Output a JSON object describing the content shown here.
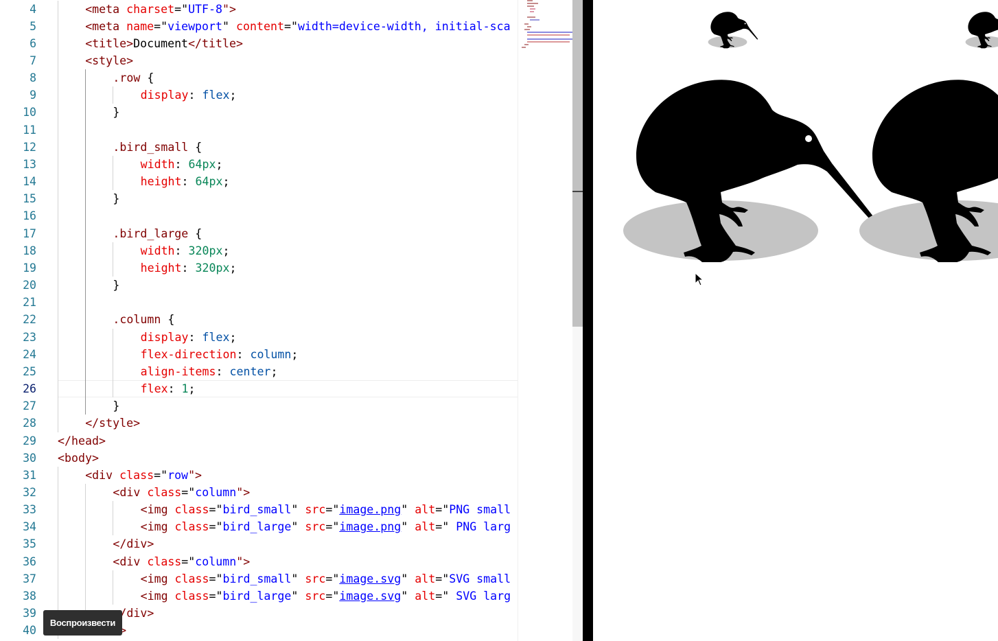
{
  "editor": {
    "active_line": "26",
    "lines": [
      {
        "n": "4",
        "indent": 1,
        "tokens": [
          {
            "t": "<meta ",
            "c": "tag"
          },
          {
            "t": "charset",
            "c": "attr"
          },
          {
            "t": "=\"",
            "c": "txt"
          },
          {
            "t": "UTF-8",
            "c": "str"
          },
          {
            "t": "\">",
            "c": "tag"
          }
        ]
      },
      {
        "n": "5",
        "indent": 1,
        "tokens": [
          {
            "t": "<meta ",
            "c": "tag"
          },
          {
            "t": "name",
            "c": "attr"
          },
          {
            "t": "=\"",
            "c": "txt"
          },
          {
            "t": "viewport",
            "c": "str"
          },
          {
            "t": "\" ",
            "c": "txt"
          },
          {
            "t": "content",
            "c": "attr"
          },
          {
            "t": "=\"",
            "c": "txt"
          },
          {
            "t": "width=device-width, initial-sca",
            "c": "str"
          }
        ]
      },
      {
        "n": "6",
        "indent": 1,
        "tokens": [
          {
            "t": "<title>",
            "c": "tag"
          },
          {
            "t": "Document",
            "c": "txt"
          },
          {
            "t": "</title>",
            "c": "tag"
          }
        ]
      },
      {
        "n": "7",
        "indent": 1,
        "tokens": [
          {
            "t": "<style>",
            "c": "tag"
          }
        ]
      },
      {
        "n": "8",
        "indent": 2,
        "tokens": [
          {
            "t": ".row",
            "c": "sel"
          },
          {
            "t": " {",
            "c": "txt"
          }
        ]
      },
      {
        "n": "9",
        "indent": 3,
        "tokens": [
          {
            "t": "display",
            "c": "prop"
          },
          {
            "t": ": ",
            "c": "txt"
          },
          {
            "t": "flex",
            "c": "val"
          },
          {
            "t": ";",
            "c": "txt"
          }
        ]
      },
      {
        "n": "10",
        "indent": 2,
        "tokens": [
          {
            "t": "}",
            "c": "txt"
          }
        ]
      },
      {
        "n": "11",
        "indent": 0,
        "tokens": []
      },
      {
        "n": "12",
        "indent": 2,
        "tokens": [
          {
            "t": ".bird_small",
            "c": "sel"
          },
          {
            "t": " {",
            "c": "txt"
          }
        ]
      },
      {
        "n": "13",
        "indent": 3,
        "tokens": [
          {
            "t": "width",
            "c": "prop"
          },
          {
            "t": ": ",
            "c": "txt"
          },
          {
            "t": "64px",
            "c": "num"
          },
          {
            "t": ";",
            "c": "txt"
          }
        ]
      },
      {
        "n": "14",
        "indent": 3,
        "tokens": [
          {
            "t": "height",
            "c": "prop"
          },
          {
            "t": ": ",
            "c": "txt"
          },
          {
            "t": "64px",
            "c": "num"
          },
          {
            "t": ";",
            "c": "txt"
          }
        ]
      },
      {
        "n": "15",
        "indent": 2,
        "tokens": [
          {
            "t": "}",
            "c": "txt"
          }
        ]
      },
      {
        "n": "16",
        "indent": 0,
        "tokens": []
      },
      {
        "n": "17",
        "indent": 2,
        "tokens": [
          {
            "t": ".bird_large",
            "c": "sel"
          },
          {
            "t": " {",
            "c": "txt"
          }
        ]
      },
      {
        "n": "18",
        "indent": 3,
        "tokens": [
          {
            "t": "width",
            "c": "prop"
          },
          {
            "t": ": ",
            "c": "txt"
          },
          {
            "t": "320px",
            "c": "num"
          },
          {
            "t": ";",
            "c": "txt"
          }
        ]
      },
      {
        "n": "19",
        "indent": 3,
        "tokens": [
          {
            "t": "height",
            "c": "prop"
          },
          {
            "t": ": ",
            "c": "txt"
          },
          {
            "t": "320px",
            "c": "num"
          },
          {
            "t": ";",
            "c": "txt"
          }
        ]
      },
      {
        "n": "20",
        "indent": 2,
        "tokens": [
          {
            "t": "}",
            "c": "txt"
          }
        ]
      },
      {
        "n": "21",
        "indent": 0,
        "tokens": []
      },
      {
        "n": "22",
        "indent": 2,
        "tokens": [
          {
            "t": ".column",
            "c": "sel"
          },
          {
            "t": " {",
            "c": "txt"
          }
        ]
      },
      {
        "n": "23",
        "indent": 3,
        "tokens": [
          {
            "t": "display",
            "c": "prop"
          },
          {
            "t": ": ",
            "c": "txt"
          },
          {
            "t": "flex",
            "c": "val"
          },
          {
            "t": ";",
            "c": "txt"
          }
        ]
      },
      {
        "n": "24",
        "indent": 3,
        "tokens": [
          {
            "t": "flex-direction",
            "c": "prop"
          },
          {
            "t": ": ",
            "c": "txt"
          },
          {
            "t": "column",
            "c": "val"
          },
          {
            "t": ";",
            "c": "txt"
          }
        ]
      },
      {
        "n": "25",
        "indent": 3,
        "tokens": [
          {
            "t": "align-items",
            "c": "prop"
          },
          {
            "t": ": ",
            "c": "txt"
          },
          {
            "t": "center",
            "c": "val"
          },
          {
            "t": ";",
            "c": "txt"
          }
        ]
      },
      {
        "n": "26",
        "indent": 3,
        "tokens": [
          {
            "t": "flex",
            "c": "prop"
          },
          {
            "t": ": ",
            "c": "txt"
          },
          {
            "t": "1",
            "c": "num"
          },
          {
            "t": ";",
            "c": "txt"
          }
        ]
      },
      {
        "n": "27",
        "indent": 2,
        "tokens": [
          {
            "t": "}",
            "c": "txt"
          }
        ]
      },
      {
        "n": "28",
        "indent": 1,
        "tokens": [
          {
            "t": "</style>",
            "c": "tag"
          }
        ]
      },
      {
        "n": "29",
        "indent": 0,
        "tokens": [
          {
            "t": "</head>",
            "c": "tag"
          }
        ]
      },
      {
        "n": "30",
        "indent": 0,
        "tokens": [
          {
            "t": "<body>",
            "c": "tag"
          }
        ]
      },
      {
        "n": "31",
        "indent": 1,
        "tokens": [
          {
            "t": "<div ",
            "c": "tag"
          },
          {
            "t": "class",
            "c": "attr"
          },
          {
            "t": "=\"",
            "c": "txt"
          },
          {
            "t": "row",
            "c": "str"
          },
          {
            "t": "\">",
            "c": "tag"
          }
        ]
      },
      {
        "n": "32",
        "indent": 2,
        "tokens": [
          {
            "t": "<div ",
            "c": "tag"
          },
          {
            "t": "class",
            "c": "attr"
          },
          {
            "t": "=\"",
            "c": "txt"
          },
          {
            "t": "column",
            "c": "str"
          },
          {
            "t": "\">",
            "c": "tag"
          }
        ]
      },
      {
        "n": "33",
        "indent": 3,
        "tokens": [
          {
            "t": "<img ",
            "c": "tag"
          },
          {
            "t": "class",
            "c": "attr"
          },
          {
            "t": "=\"",
            "c": "txt"
          },
          {
            "t": "bird_small",
            "c": "str"
          },
          {
            "t": "\" ",
            "c": "txt"
          },
          {
            "t": "src",
            "c": "attr"
          },
          {
            "t": "=\"",
            "c": "txt"
          },
          {
            "t": "image.png",
            "c": "link"
          },
          {
            "t": "\" ",
            "c": "txt"
          },
          {
            "t": "alt",
            "c": "attr"
          },
          {
            "t": "=\"",
            "c": "txt"
          },
          {
            "t": "PNG small",
            "c": "str"
          }
        ]
      },
      {
        "n": "34",
        "indent": 3,
        "tokens": [
          {
            "t": "<img ",
            "c": "tag"
          },
          {
            "t": "class",
            "c": "attr"
          },
          {
            "t": "=\"",
            "c": "txt"
          },
          {
            "t": "bird_large",
            "c": "str"
          },
          {
            "t": "\" ",
            "c": "txt"
          },
          {
            "t": "src",
            "c": "attr"
          },
          {
            "t": "=\"",
            "c": "txt"
          },
          {
            "t": "image.png",
            "c": "link"
          },
          {
            "t": "\" ",
            "c": "txt"
          },
          {
            "t": "alt",
            "c": "attr"
          },
          {
            "t": "=\"",
            "c": "txt"
          },
          {
            "t": " PNG larg",
            "c": "str"
          }
        ]
      },
      {
        "n": "35",
        "indent": 2,
        "tokens": [
          {
            "t": "</div>",
            "c": "tag"
          }
        ]
      },
      {
        "n": "36",
        "indent": 2,
        "tokens": [
          {
            "t": "<div ",
            "c": "tag"
          },
          {
            "t": "class",
            "c": "attr"
          },
          {
            "t": "=\"",
            "c": "txt"
          },
          {
            "t": "column",
            "c": "str"
          },
          {
            "t": "\">",
            "c": "tag"
          }
        ]
      },
      {
        "n": "37",
        "indent": 3,
        "tokens": [
          {
            "t": "<img ",
            "c": "tag"
          },
          {
            "t": "class",
            "c": "attr"
          },
          {
            "t": "=\"",
            "c": "txt"
          },
          {
            "t": "bird_small",
            "c": "str"
          },
          {
            "t": "\" ",
            "c": "txt"
          },
          {
            "t": "src",
            "c": "attr"
          },
          {
            "t": "=\"",
            "c": "txt"
          },
          {
            "t": "image.svg",
            "c": "link"
          },
          {
            "t": "\" ",
            "c": "txt"
          },
          {
            "t": "alt",
            "c": "attr"
          },
          {
            "t": "=\"",
            "c": "txt"
          },
          {
            "t": "SVG small",
            "c": "str"
          }
        ]
      },
      {
        "n": "38",
        "indent": 3,
        "tokens": [
          {
            "t": "<img ",
            "c": "tag"
          },
          {
            "t": "class",
            "c": "attr"
          },
          {
            "t": "=\"",
            "c": "txt"
          },
          {
            "t": "bird_large",
            "c": "str"
          },
          {
            "t": "\" ",
            "c": "txt"
          },
          {
            "t": "src",
            "c": "attr"
          },
          {
            "t": "=\"",
            "c": "txt"
          },
          {
            "t": "image.svg",
            "c": "link"
          },
          {
            "t": "\" ",
            "c": "txt"
          },
          {
            "t": "alt",
            "c": "attr"
          },
          {
            "t": "=\"",
            "c": "txt"
          },
          {
            "t": " SVG larg",
            "c": "str"
          }
        ]
      },
      {
        "n": "39",
        "indent": 2,
        "tokens": [
          {
            "t": "</div>",
            "c": "tag"
          }
        ]
      },
      {
        "n": "40",
        "indent": 1,
        "tokens": [
          {
            "t": "</div>",
            "c": "tag"
          }
        ]
      }
    ]
  },
  "tooltip": {
    "play_label": "Воспроизвести"
  },
  "colors": {
    "tag": "#800000",
    "attribute": "#e50000",
    "string": "#0000ff",
    "property": "#e50000",
    "value": "#0451a5",
    "number": "#098658",
    "line_number": "#237893",
    "divider": "#000000",
    "bird": "#000000",
    "shadow": "#c4c4c4"
  },
  "preview": {
    "images": [
      {
        "name": "kiwi-bird-small-png",
        "icon": "kiwi-bird-icon"
      },
      {
        "name": "kiwi-bird-large-png",
        "icon": "kiwi-bird-icon"
      },
      {
        "name": "kiwi-bird-small-svg",
        "icon": "kiwi-bird-icon"
      },
      {
        "name": "kiwi-bird-large-svg",
        "icon": "kiwi-bird-icon"
      }
    ]
  }
}
